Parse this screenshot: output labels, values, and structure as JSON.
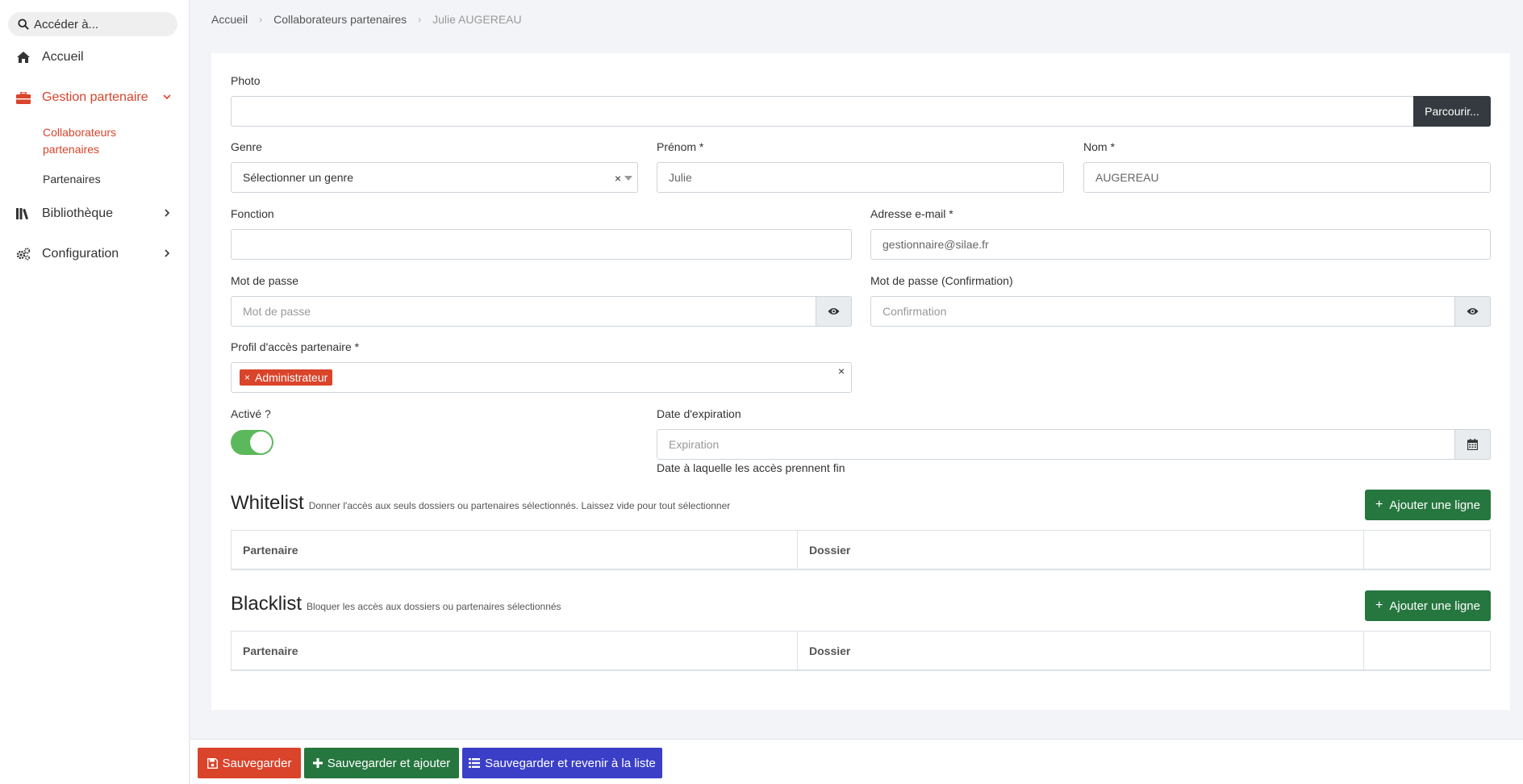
{
  "sidebar": {
    "search_placeholder": "Accéder à...",
    "items": [
      {
        "label": "Accueil"
      },
      {
        "label": "Gestion partenaire"
      },
      {
        "label": "Bibliothèque"
      },
      {
        "label": "Configuration"
      }
    ],
    "sub_items": [
      {
        "label": "Collaborateurs partenaires"
      },
      {
        "label": "Partenaires"
      }
    ],
    "accent_color": "#d9442b"
  },
  "breadcrumb": [
    "Accueil",
    "Collaborateurs partenaires",
    "Julie AUGEREAU"
  ],
  "form": {
    "photo": {
      "label": "Photo",
      "value": "",
      "browse_label": "Parcourir..."
    },
    "genre": {
      "label": "Genre",
      "placeholder": "Sélectionner un genre",
      "clear": "×"
    },
    "prenom": {
      "label": "Prénom *",
      "value": "Julie"
    },
    "nom": {
      "label": "Nom *",
      "value": "AUGEREAU"
    },
    "fonction": {
      "label": "Fonction",
      "value": ""
    },
    "email": {
      "label": "Adresse e-mail *",
      "value": "gestionnaire@silae.fr"
    },
    "password": {
      "label": "Mot de passe",
      "placeholder": "Mot de passe"
    },
    "password_confirm": {
      "label": "Mot de passe (Confirmation)",
      "placeholder": "Confirmation"
    },
    "profil": {
      "label": "Profil d'accès partenaire *",
      "tag": "Administrateur",
      "tag_remove": "×",
      "clear": "×"
    },
    "active": {
      "label": "Activé ?",
      "checked": true
    },
    "expiration": {
      "label": "Date d'expiration",
      "placeholder": "Expiration",
      "help": "Date à laquelle les accès prennent fin"
    }
  },
  "whitelist": {
    "title": "Whitelist",
    "description": "Donner l'accès aux seuls dossiers ou partenaires sélectionnés. Laissez vide pour tout sélectionner",
    "add_button": "Ajouter une ligne",
    "columns": [
      "Partenaire",
      "Dossier",
      ""
    ]
  },
  "blacklist": {
    "title": "Blacklist",
    "description": "Bloquer les accès aux dossiers ou partenaires sélectionnés",
    "add_button": "Ajouter une ligne",
    "columns": [
      "Partenaire",
      "Dossier",
      ""
    ]
  },
  "footer": {
    "save": "Sauvegarder",
    "save_add": "Sauvegarder et ajouter",
    "save_return": "Sauvegarder et revenir à la liste"
  },
  "colors": {
    "danger": "#d9442b",
    "success": "#26763f",
    "primary": "#3b3fc7",
    "toggle_on": "#5cb85c",
    "dark": "#343a40"
  }
}
